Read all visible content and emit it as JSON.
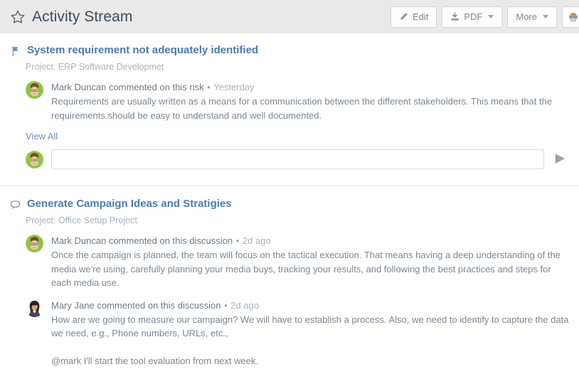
{
  "header": {
    "title": "Activity Stream",
    "star_icon": "star-outline-icon",
    "toolbar": {
      "edit_label": "Edit",
      "edit_icon": "pencil-icon",
      "pdf_label": "PDF",
      "pdf_icon": "download-icon",
      "pdf_caret": "chevron-down-icon",
      "more_label": "More",
      "more_caret": "chevron-down-icon",
      "print_icon": "printer-icon"
    }
  },
  "colors": {
    "header_bg": "#eaeaea",
    "title_text": "#3d4c5c",
    "link_blue": "#4a7ab5",
    "body_text": "#7b8794",
    "muted_text": "#a9b2bb"
  },
  "activities": [
    {
      "icon": "risk-flag-icon",
      "title": "System requirement not adequately identified",
      "project": "Project: ERP Software Developmet",
      "comments": [
        {
          "avatar": "avatar-mark-duncan",
          "author": "Mark Duncan",
          "action": "commented on this risk",
          "separator": "•",
          "time": "Yesterday",
          "text": "Requirements are usually written as a means for a communication between the different stakeholders. This means that the requirements should be easy to understand and well documented."
        }
      ],
      "view_all_label": "View All",
      "reply": {
        "avatar": "avatar-mark-duncan",
        "value": "",
        "placeholder": "",
        "send_icon": "send-arrow-icon"
      }
    },
    {
      "icon": "discussion-bubble-icon",
      "title": "Generate Campaign Ideas and Stratigies",
      "project": "Project: Office Setup Project",
      "comments": [
        {
          "avatar": "avatar-mark-duncan",
          "author": "Mark Duncan",
          "action": "commented on this discussion",
          "separator": "•",
          "time": "2d ago",
          "text": "Once the campaign is planned, the team will focus on the tactical execution. That means having a deep understanding of the media we're using, carefully planning your media buys, tracking your results, and following the best practices and steps for each media use."
        },
        {
          "avatar": "avatar-mary-jane",
          "author": "Mary Jane",
          "action": "commented on this discussion",
          "separator": "•",
          "time": "2d ago",
          "text": "How are we going to measure our campaign? We will have to establish a process. Also, we need to identify to capture the data we need, e.g., Phone numbers, URLs, etc.,\n\n@mark I'll start the tool evaluation from next week."
        }
      ]
    }
  ]
}
